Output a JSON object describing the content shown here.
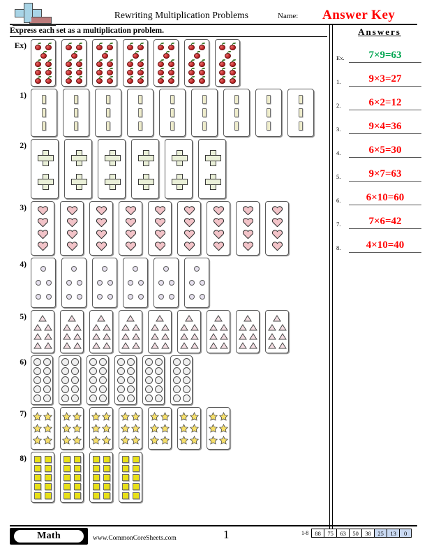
{
  "header": {
    "logo_name": "commoncoresheets-plus-logo",
    "title": "Rewriting Multiplication Problems",
    "name_label": "Name:",
    "answer_key_text": "Answer Key",
    "answer_key_color": "#ff0000"
  },
  "directions": "Express each set as a multiplication problem.",
  "answers_panel": {
    "title": "Answers",
    "rows": [
      {
        "num": "Ex.",
        "value": "7×9=63",
        "color": "#00a550"
      },
      {
        "num": "1.",
        "value": "9×3=27",
        "color": "#ff0000"
      },
      {
        "num": "2.",
        "value": "6×2=12",
        "color": "#ff0000"
      },
      {
        "num": "3.",
        "value": "9×4=36",
        "color": "#ff0000"
      },
      {
        "num": "4.",
        "value": "6×5=30",
        "color": "#ff0000"
      },
      {
        "num": "5.",
        "value": "9×7=63",
        "color": "#ff0000"
      },
      {
        "num": "6.",
        "value": "6×10=60",
        "color": "#ff0000"
      },
      {
        "num": "7.",
        "value": "7×6=42",
        "color": "#ff0000"
      },
      {
        "num": "8.",
        "value": "4×10=40",
        "color": "#ff0000"
      }
    ]
  },
  "problems": [
    {
      "label": "Ex)",
      "shape": "cherry",
      "groups": 7,
      "per_group": 9,
      "group_class": "grp-cherry",
      "rows": [
        2,
        1,
        2,
        2,
        2
      ]
    },
    {
      "label": "1)",
      "shape": "bar",
      "groups": 9,
      "per_group": 3,
      "group_class": "grp-bar",
      "rows": [
        1,
        1,
        1
      ]
    },
    {
      "label": "2)",
      "shape": "plus",
      "groups": 6,
      "per_group": 2,
      "group_class": "grp-plus",
      "rows": [
        1,
        1
      ]
    },
    {
      "label": "3)",
      "shape": "heart",
      "groups": 9,
      "per_group": 4,
      "group_class": "grp-heart",
      "rows": [
        1,
        1,
        1,
        1
      ]
    },
    {
      "label": "4)",
      "shape": "circle",
      "groups": 6,
      "per_group": 5,
      "group_class": "grp-dot",
      "rows": [
        1,
        2,
        2
      ]
    },
    {
      "label": "5)",
      "shape": "triangle",
      "groups": 9,
      "per_group": 7,
      "group_class": "grp-tri",
      "rows": [
        1,
        2,
        2,
        2
      ]
    },
    {
      "label": "6)",
      "shape": "ring",
      "groups": 6,
      "per_group": 10,
      "group_class": "grp-ring",
      "rows": [
        2,
        2,
        2,
        2,
        2
      ]
    },
    {
      "label": "7)",
      "shape": "star",
      "groups": 7,
      "per_group": 6,
      "group_class": "grp-star",
      "rows": [
        2,
        2,
        2
      ]
    },
    {
      "label": "8)",
      "shape": "square",
      "groups": 4,
      "per_group": 10,
      "group_class": "grp-sq",
      "rows": [
        2,
        2,
        2,
        2,
        2
      ]
    }
  ],
  "footer": {
    "subject_badge": "Math",
    "site_url": "www.CommonCoreSheets.com",
    "page_number": "1",
    "scale_range": "1-8",
    "scale_values": [
      "88",
      "75",
      "63",
      "50",
      "38",
      "25",
      "13",
      "0"
    ],
    "scale_highlighted": [
      "25",
      "13",
      "0"
    ],
    "scale_highlight_color": "#c9d9f2"
  }
}
